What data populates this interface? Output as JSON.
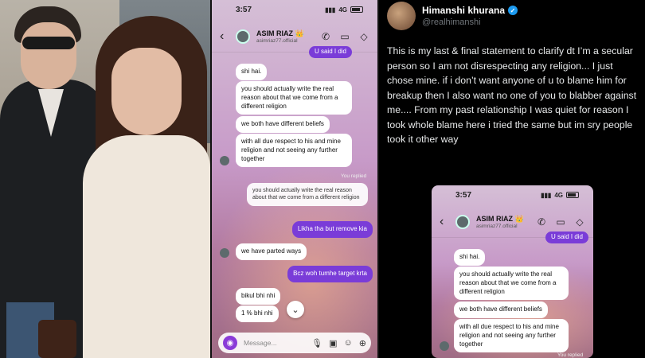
{
  "left_photo": {
    "description_hidden": ""
  },
  "chat": {
    "time": "3:57",
    "network": "4G",
    "contact_name": "ASIM RIAZ",
    "contact_badge": "👑",
    "contact_handle": "asimriaz77.official",
    "top_partial_out": "U said I did",
    "messages": {
      "m1": "shi hai.",
      "m2": "you should actually write the real reason about that we come from a different religion",
      "m3": "we both have different beliefs",
      "m4": "with all due respect to his and mine religion and not seeing any further together",
      "you_replied": "You replied",
      "m5_reply": "you should actually write the real reason about that we come from a different religion",
      "m6_out": "Likha tha but remove kia",
      "m7": "we have parted ways",
      "m8_out": "Bcz woh tumhe target krta",
      "m9": "bikul bhi nhi",
      "m10": "1 % bhi nhi"
    },
    "composer_placeholder": "Message..."
  },
  "tweet": {
    "name": "Himanshi khurana",
    "handle": "@realhimanshi",
    "text": "This is my last & final statement to clarify dt I’m a secular person so I am not disrespecting  any religion... I just chose mine. if i don’t want anyone of u to blame him for breakup then I also want no one of you to blabber against me.... From my past relationship I was quiet for reason I took whole blame here i tried the same but im sry people took it other way"
  },
  "colors": {
    "accent_purple": "#7a3cd8",
    "verified_blue": "#1d9bf0"
  },
  "icons": [
    "back-arrow-icon",
    "phone-icon",
    "video-icon",
    "tag-icon",
    "camera-icon",
    "mic-icon",
    "image-icon",
    "plus-icon",
    "chevron-down-icon",
    "verified-icon"
  ]
}
